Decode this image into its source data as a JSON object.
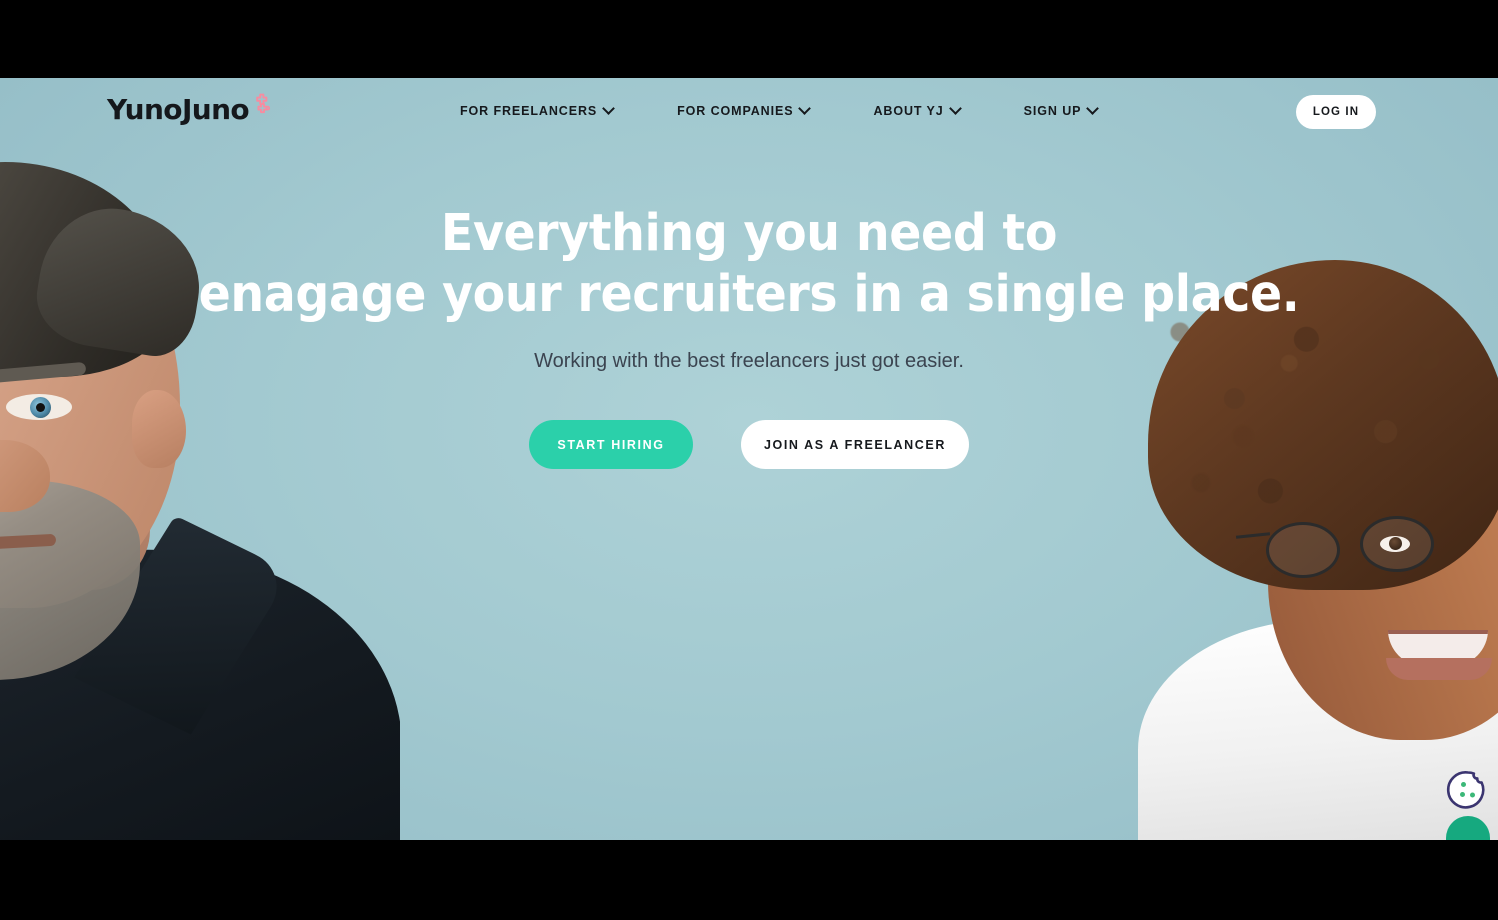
{
  "meta": {
    "page_kind": "marketing-landing-hero",
    "background_color": "#a3c9d1",
    "letterbox_color": "#000000"
  },
  "brand": {
    "name": "YunoJuno",
    "logo_text": "YunoJuno",
    "logo_mark_name": "yunojuno-flower-icon",
    "logo_mark_color": "#f78ca0",
    "logo_text_color": "#15181c"
  },
  "nav": {
    "items": [
      {
        "label": "FOR FREELANCERS",
        "has_dropdown": true,
        "icon": "chevron-down-icon"
      },
      {
        "label": "FOR COMPANIES",
        "has_dropdown": true,
        "icon": "chevron-down-icon"
      },
      {
        "label": "ABOUT YJ",
        "has_dropdown": true,
        "icon": "chevron-down-icon"
      },
      {
        "label": "SIGN UP",
        "has_dropdown": true,
        "icon": "chevron-down-icon"
      }
    ],
    "login_label": "LOG IN"
  },
  "hero": {
    "headline_line1": "Everything you need to",
    "headline_line2": "enagage your recruiters in a single place.",
    "subheadline": "Working with the best freelancers just got easier.",
    "headline_color": "#ffffff",
    "subheadline_color": "#3b4450",
    "cta_primary": {
      "label": "START HIRING",
      "background": "#2bd0aa",
      "text_color": "#ffffff"
    },
    "cta_secondary": {
      "label": "JOIN AS A FREELANCER",
      "background": "#ffffff",
      "text_color": "#16191d"
    }
  },
  "imagery": {
    "left_subject": "Man with grey hair and beard wearing a dark navy shirt",
    "right_subject": "Smiling young woman with curly hair and round glasses in a white t-shirt"
  },
  "cookie_widget": {
    "icon_name": "cookie-icon",
    "outline_color": "#3b3570",
    "dot_color": "#3cb878",
    "accent_color": "#16a97f"
  }
}
